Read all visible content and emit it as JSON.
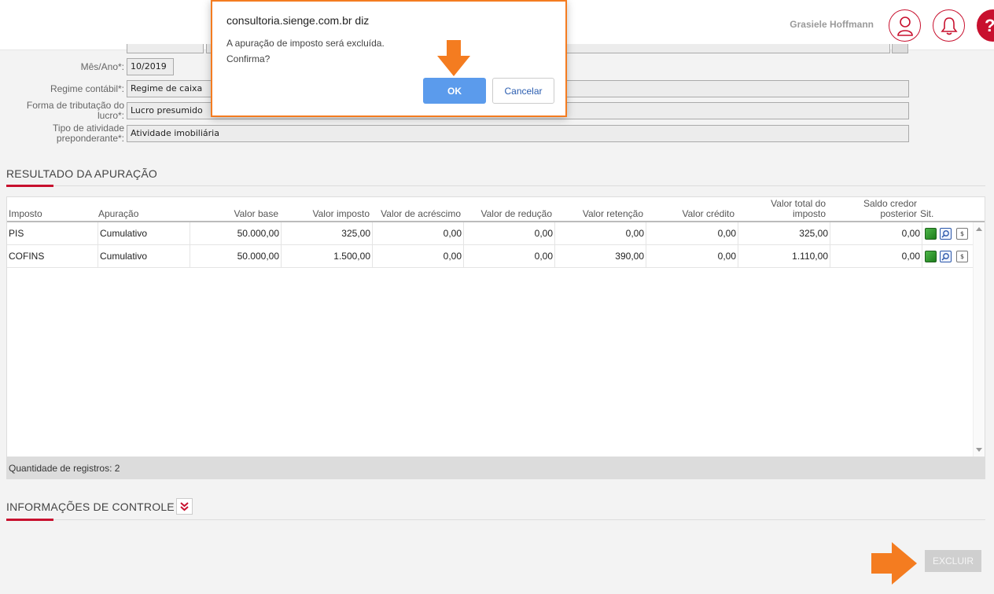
{
  "header": {
    "user_name": "Grasiele Hoffmann",
    "help_symbol": "?",
    "icons": [
      "user-icon",
      "bell-icon",
      "help-icon"
    ],
    "accent_color": "#c8102e"
  },
  "form": {
    "mes_ano": {
      "label": "Mês/Ano*:",
      "value": "10/2019"
    },
    "regime_contabil": {
      "label": "Regime contábil*:",
      "value": "Regime de caixa"
    },
    "forma_tributacao": {
      "label_line1": "Forma de tributação do",
      "label_line2": "lucro*:",
      "value": "Lucro presumido"
    },
    "tipo_atividade": {
      "label_line1": "Tipo de atividade",
      "label_line2": "preponderante*:",
      "value": "Atividade imobiliária"
    }
  },
  "resultado": {
    "title": "RESULTADO DA APURAÇÃO",
    "headers": {
      "imposto": "Imposto",
      "apuracao": "Apuração",
      "valor_base": "Valor base",
      "valor_imposto": "Valor imposto",
      "valor_acrescimo": "Valor de acréscimo",
      "valor_reducao": "Valor de redução",
      "valor_retencao": "Valor retenção",
      "valor_credito": "Valor crédito",
      "valor_total_l1": "Valor total do",
      "valor_total_l2": "imposto",
      "saldo_l1": "Saldo credor",
      "saldo_l2": "posterior",
      "situacao": "Sit."
    },
    "rows": [
      {
        "imposto": "PIS",
        "apuracao": "Cumulativo",
        "valor_base": "50.000,00",
        "valor_imposto": "325,00",
        "valor_acrescimo": "0,00",
        "valor_reducao": "0,00",
        "valor_retencao": "0,00",
        "valor_credito": "0,00",
        "valor_total": "325,00",
        "saldo": "0,00",
        "doc_symbol": "$"
      },
      {
        "imposto": "COFINS",
        "apuracao": "Cumulativo",
        "valor_base": "50.000,00",
        "valor_imposto": "1.500,00",
        "valor_acrescimo": "0,00",
        "valor_reducao": "0,00",
        "valor_retencao": "390,00",
        "valor_credito": "0,00",
        "valor_total": "1.110,00",
        "saldo": "0,00",
        "doc_symbol": "$"
      }
    ],
    "footer": "Quantidade de registros: 2"
  },
  "controle": {
    "title": "INFORMAÇÕES DE CONTROLE",
    "expand_icon": "double-chevron-down-icon"
  },
  "actions": {
    "excluir_label": "EXCLUIR"
  },
  "dialog": {
    "origin": "consultoria.sienge.com.br diz",
    "message_line1": "A apuração de imposto será excluída.",
    "message_line2": "Confirma?",
    "ok_label": "OK",
    "cancel_label": "Cancelar",
    "highlight_color": "#f47c20"
  }
}
